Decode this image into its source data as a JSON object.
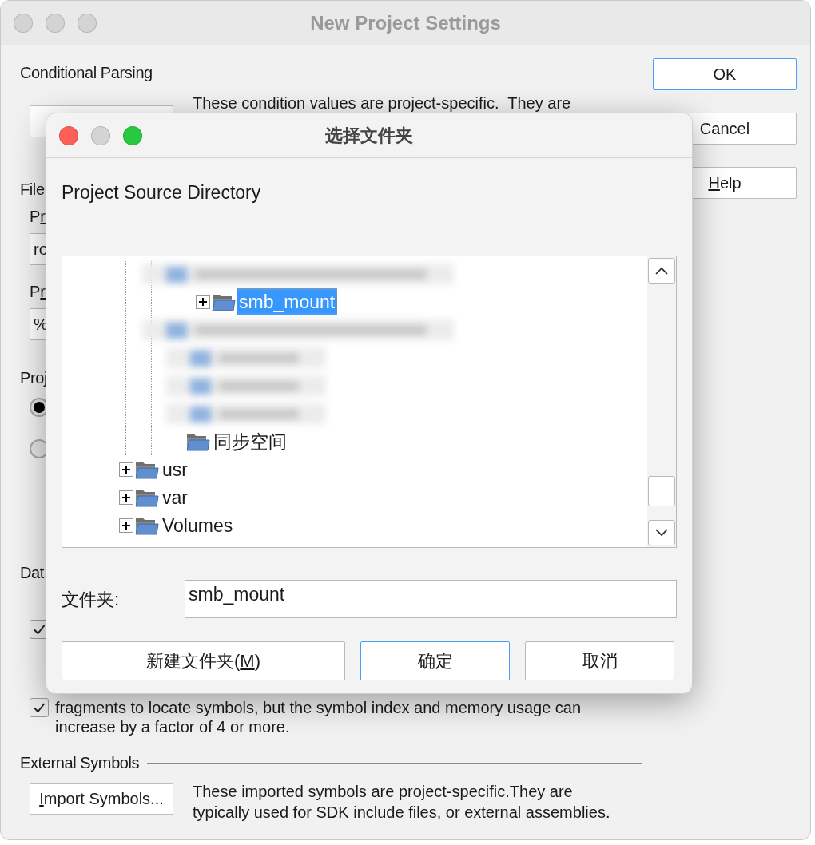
{
  "window": {
    "title": "New Project Settings",
    "active": false
  },
  "conditional_parsing": {
    "heading": "Conditional Parsing",
    "description": "These condition values are project-specific.  They are"
  },
  "file_section": {
    "heading": "File",
    "fields": [
      {
        "label": "Pr",
        "value": "ro"
      },
      {
        "label": "Pr",
        "value": "%"
      }
    ]
  },
  "project_section": {
    "heading": "Proj",
    "radios": [
      {
        "selected": true
      },
      {
        "selected": false
      }
    ]
  },
  "data_section": {
    "heading": "Dat",
    "checkboxes": [
      {
        "checked": true
      },
      {
        "checked": true,
        "lines": [
          "fragments to locate symbols, but the symbol index and memory usage can",
          "increase by a factor of 4 or more."
        ]
      }
    ]
  },
  "external_symbols": {
    "heading": "External Symbols",
    "button": {
      "label": "Import Symbols..."
    },
    "description": [
      "These imported symbols are project-specific.They are",
      "typically used for SDK include files, or external assemblies."
    ]
  },
  "side_buttons": [
    {
      "label": "OK",
      "default": true
    },
    {
      "label": "Cancel",
      "default": false
    },
    {
      "label": "Help",
      "default": false
    }
  ],
  "dialog": {
    "title": "选择文件夹",
    "prompt": "Project Source Directory",
    "tree": {
      "items": [
        {
          "kind": "offscreen",
          "children": [
            {
              "kind": "offscreen",
              "children": [
                {
                  "kind": "offscreen",
                  "children": [
                    {
                      "kind": "redacted",
                      "wide": true
                    },
                    {
                      "kind": "folder",
                      "label": "smb_mount",
                      "expandable": true,
                      "selected": true
                    },
                    {
                      "kind": "redacted",
                      "wide": true
                    },
                    {
                      "kind": "redacted",
                      "wide": false
                    },
                    {
                      "kind": "redacted",
                      "wide": false
                    },
                    {
                      "kind": "redacted",
                      "wide": false
                    }
                  ]
                },
                {
                  "kind": "folder",
                  "label": "同步空间",
                  "expandable": false,
                  "selected": false
                }
              ]
            }
          ]
        },
        {
          "kind": "folder",
          "label": "usr",
          "expandable": true,
          "selected": false
        },
        {
          "kind": "folder",
          "label": "var",
          "expandable": true,
          "selected": false
        },
        {
          "kind": "folder",
          "label": "Volumes",
          "expandable": true,
          "selected": false
        }
      ]
    },
    "folder_field": {
      "label": "文件夹:",
      "value": "smb_mount"
    },
    "buttons": [
      {
        "label": "新建文件夹(M)",
        "default": false
      },
      {
        "label": "确定",
        "default": true
      },
      {
        "label": "取消",
        "default": false
      }
    ]
  }
}
